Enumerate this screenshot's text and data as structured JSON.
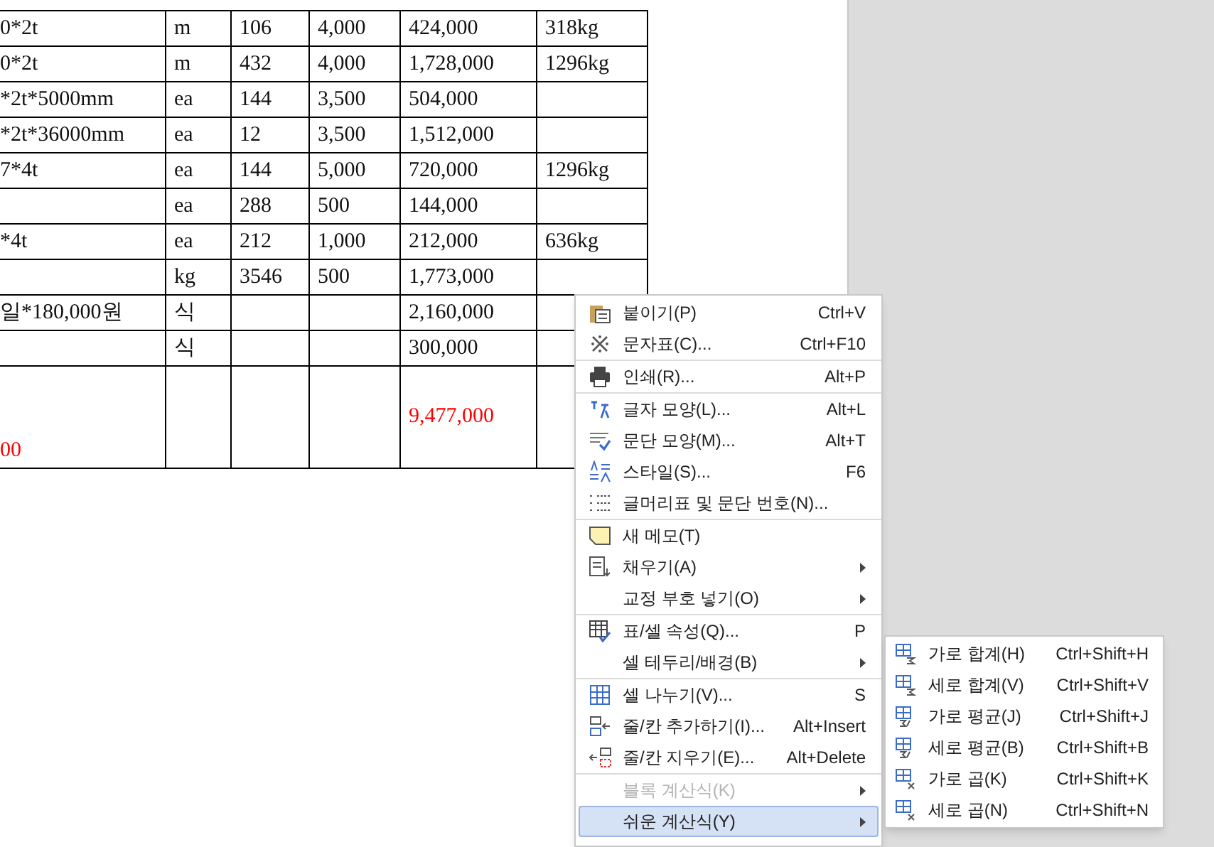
{
  "table": {
    "rows": [
      {
        "cells": [
          {
            "text": "0*2t"
          },
          {
            "text": "m"
          },
          {
            "text": "106"
          },
          {
            "text": "4,000"
          },
          {
            "text": "424,000"
          },
          {
            "text": "318kg"
          }
        ]
      },
      {
        "cells": [
          {
            "text": "0*2t"
          },
          {
            "text": "m"
          },
          {
            "text": "432"
          },
          {
            "text": "4,000"
          },
          {
            "text": "1,728,000"
          },
          {
            "text": "1296kg"
          }
        ]
      },
      {
        "cells": [
          {
            "text": "*2t*5000mm"
          },
          {
            "text": "ea"
          },
          {
            "text": "144"
          },
          {
            "text": "3,500"
          },
          {
            "text": "504,000"
          },
          {
            "text": ""
          }
        ]
      },
      {
        "cells": [
          {
            "text": "*2t*36000mm"
          },
          {
            "text": "ea"
          },
          {
            "text": "12"
          },
          {
            "text": "3,500"
          },
          {
            "text": "1,512,000"
          },
          {
            "text": ""
          }
        ]
      },
      {
        "cells": [
          {
            "text": "7*4t"
          },
          {
            "text": "ea"
          },
          {
            "text": "144"
          },
          {
            "text": "5,000"
          },
          {
            "text": "720,000"
          },
          {
            "text": "1296kg"
          }
        ]
      },
      {
        "cells": [
          {
            "text": ""
          },
          {
            "text": "ea"
          },
          {
            "text": "288"
          },
          {
            "text": "500"
          },
          {
            "text": "144,000"
          },
          {
            "text": ""
          }
        ]
      },
      {
        "cells": [
          {
            "text": "*4t"
          },
          {
            "text": "ea"
          },
          {
            "text": "212"
          },
          {
            "text": "1,000"
          },
          {
            "text": "212,000"
          },
          {
            "text": "636kg"
          }
        ]
      },
      {
        "cells": [
          {
            "text": ""
          },
          {
            "text": "kg"
          },
          {
            "text": "3546"
          },
          {
            "text": "500"
          },
          {
            "text": "1,773,000"
          },
          {
            "text": ""
          }
        ]
      },
      {
        "cells": [
          {
            "text": "일*180,000원"
          },
          {
            "text": "식"
          },
          {
            "text": ""
          },
          {
            "text": ""
          },
          {
            "text": "2,160,000"
          },
          {
            "text": ""
          }
        ]
      },
      {
        "cells": [
          {
            "text": ""
          },
          {
            "text": "식"
          },
          {
            "text": ""
          },
          {
            "text": ""
          },
          {
            "text": "300,000"
          },
          {
            "text": ""
          }
        ]
      },
      {
        "tall": true,
        "cells": [
          {
            "text": "00",
            "color": "#ff0000"
          },
          {
            "text": ""
          },
          {
            "text": ""
          },
          {
            "text": ""
          },
          {
            "text": "9,477,000",
            "color": "#ff0000"
          },
          {
            "text": ""
          }
        ]
      }
    ]
  },
  "context_menu": {
    "groups": [
      [
        {
          "label": "붙이기(P)",
          "shortcut": "Ctrl+V",
          "submenu": false,
          "disabled": false,
          "selected": false
        },
        {
          "label": "문자표(C)...",
          "shortcut": "Ctrl+F10",
          "submenu": false,
          "disabled": false,
          "selected": false
        }
      ],
      [
        {
          "label": "인쇄(R)...",
          "shortcut": "Alt+P",
          "submenu": false,
          "disabled": false,
          "selected": false
        }
      ],
      [
        {
          "label": "글자 모양(L)...",
          "shortcut": "Alt+L",
          "submenu": false,
          "disabled": false,
          "selected": false
        },
        {
          "label": "문단 모양(M)...",
          "shortcut": "Alt+T",
          "submenu": false,
          "disabled": false,
          "selected": false
        },
        {
          "label": "스타일(S)...",
          "shortcut": "F6",
          "submenu": false,
          "disabled": false,
          "selected": false
        },
        {
          "label": "글머리표 및 문단 번호(N)...",
          "submenu": false,
          "disabled": false,
          "selected": false
        }
      ],
      [
        {
          "label": "새 메모(T)",
          "submenu": false,
          "disabled": false,
          "selected": false
        },
        {
          "label": "채우기(A)",
          "submenu": true,
          "disabled": false,
          "selected": false
        },
        {
          "label": "교정 부호 넣기(O)",
          "submenu": true,
          "disabled": false,
          "selected": false
        }
      ],
      [
        {
          "label": "표/셀 속성(Q)...",
          "shortcut": "P",
          "submenu": false,
          "disabled": false,
          "selected": false
        },
        {
          "label": "셀 테두리/배경(B)",
          "submenu": true,
          "disabled": false,
          "selected": false
        }
      ],
      [
        {
          "label": "셀 나누기(V)...",
          "shortcut": "S",
          "submenu": false,
          "disabled": false,
          "selected": false
        },
        {
          "label": "줄/칸 추가하기(I)...",
          "shortcut": "Alt+Insert",
          "submenu": false,
          "disabled": false,
          "selected": false
        },
        {
          "label": "줄/칸 지우기(E)...",
          "shortcut": "Alt+Delete",
          "submenu": false,
          "disabled": false,
          "selected": false
        }
      ],
      [
        {
          "label": "블록 계산식(K)",
          "submenu": true,
          "disabled": true,
          "selected": false
        },
        {
          "label": "쉬운 계산식(Y)",
          "submenu": true,
          "disabled": false,
          "selected": true
        }
      ]
    ]
  },
  "submenu": {
    "items": [
      {
        "label": "가로 합계(H)",
        "shortcut": "Ctrl+Shift+H"
      },
      {
        "label": "세로 합계(V)",
        "shortcut": "Ctrl+Shift+V"
      },
      {
        "label": "가로 평균(J)",
        "shortcut": "Ctrl+Shift+J"
      },
      {
        "label": "세로 평균(B)",
        "shortcut": "Ctrl+Shift+B"
      },
      {
        "label": "가로 곱(K)",
        "shortcut": "Ctrl+Shift+K"
      },
      {
        "label": "세로 곱(N)",
        "shortcut": "Ctrl+Shift+N"
      }
    ]
  }
}
